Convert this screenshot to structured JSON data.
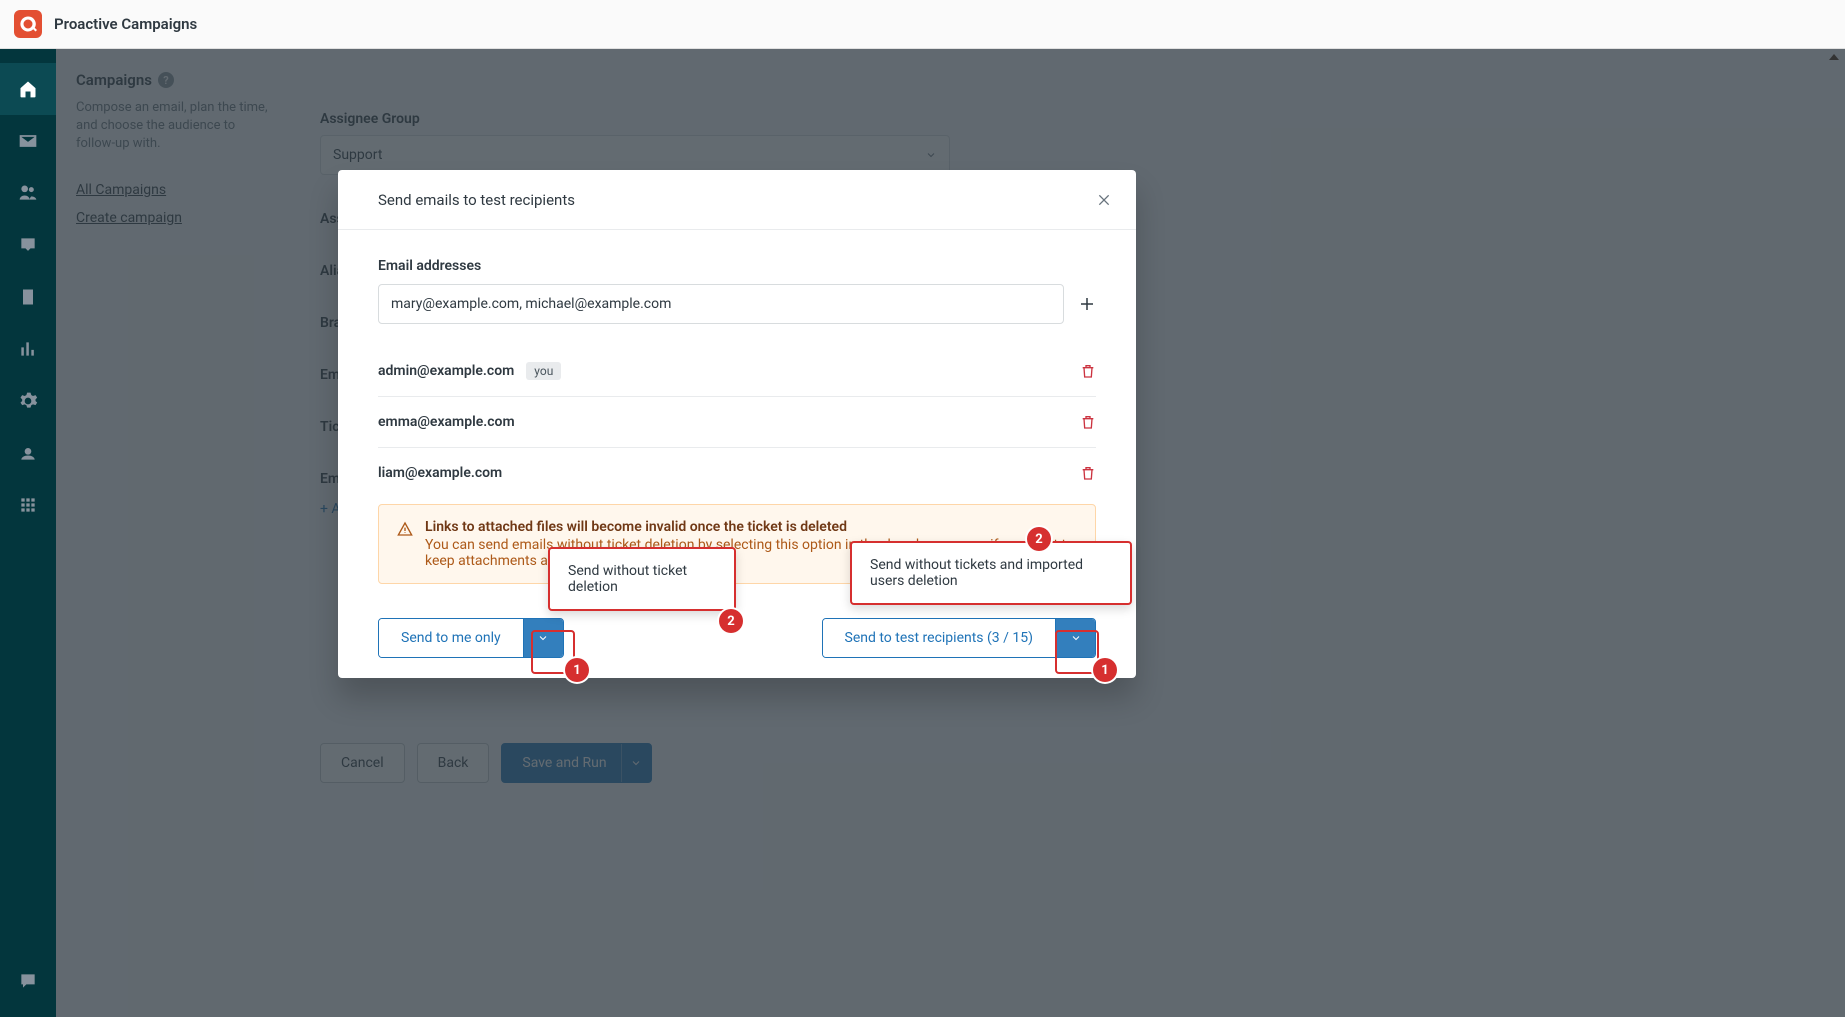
{
  "app": {
    "title": "Proactive Campaigns"
  },
  "sidebar": {
    "heading": "Campaigns",
    "desc": "Compose an email, plan the time, and choose the audience to follow-up with.",
    "links": [
      "All Campaigns",
      "Create campaign"
    ]
  },
  "form": {
    "assignee_group_label": "Assignee Group",
    "assignee_group_value": "Support",
    "assignee_label": "Ass",
    "alias_label": "Alia",
    "brand_label": "Bra",
    "email_label": "Em",
    "tic_label": "Tic",
    "em2_label": "Em",
    "add_link": "+ A",
    "cancel": "Cancel",
    "back": "Back",
    "save_run": "Save and Run"
  },
  "modal": {
    "title": "Send emails to test recipients",
    "email_label": "Email addresses",
    "email_value": "mary@example.com, michael@example.com",
    "recipients": [
      {
        "addr": "admin@example.com",
        "you": true
      },
      {
        "addr": "emma@example.com",
        "you": false
      },
      {
        "addr": "liam@example.com",
        "you": false
      }
    ],
    "you_badge": "you",
    "warn_title": "Links to attached files will become invalid once the ticket is deleted",
    "warn_text": "You can send emails without ticket deletion by selecting this option in the dropdown menu, if you want to keep attachments available.",
    "send_me": "Send to me only",
    "send_test": "Send to test recipients (3 / 15)"
  },
  "callouts": {
    "c1": "Send without ticket deletion",
    "c2": "Send without tickets and imported users deletion",
    "n1": "1",
    "n2": "2"
  }
}
